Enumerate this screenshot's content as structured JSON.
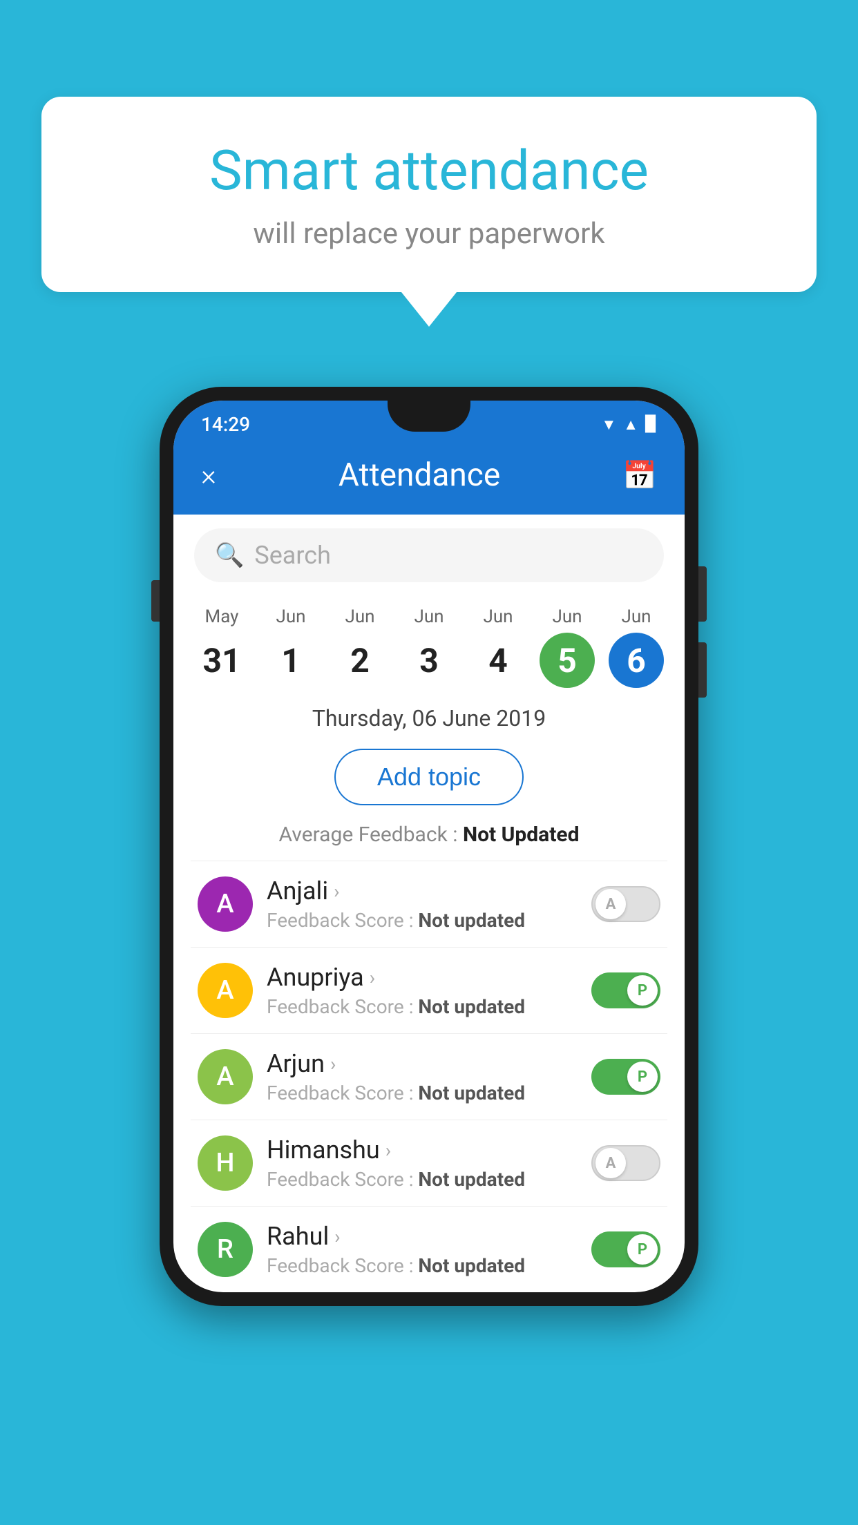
{
  "background_color": "#29b6d8",
  "speech_bubble": {
    "title": "Smart attendance",
    "subtitle": "will replace your paperwork"
  },
  "status_bar": {
    "time": "14:29",
    "icons": [
      "wifi",
      "signal",
      "battery"
    ]
  },
  "app_header": {
    "title": "Attendance",
    "close_label": "×",
    "calendar_icon": "📅"
  },
  "search": {
    "placeholder": "Search"
  },
  "calendar": {
    "days": [
      {
        "month": "May",
        "date": "31",
        "state": "normal"
      },
      {
        "month": "Jun",
        "date": "1",
        "state": "normal"
      },
      {
        "month": "Jun",
        "date": "2",
        "state": "normal"
      },
      {
        "month": "Jun",
        "date": "3",
        "state": "normal"
      },
      {
        "month": "Jun",
        "date": "4",
        "state": "normal"
      },
      {
        "month": "Jun",
        "date": "5",
        "state": "today"
      },
      {
        "month": "Jun",
        "date": "6",
        "state": "selected"
      }
    ]
  },
  "date_display": "Thursday, 06 June 2019",
  "add_topic_label": "Add topic",
  "average_feedback": {
    "label": "Average Feedback : ",
    "value": "Not Updated"
  },
  "students": [
    {
      "name": "Anjali",
      "avatar_letter": "A",
      "avatar_color": "#9c27b0",
      "feedback_label": "Feedback Score : ",
      "feedback_value": "Not updated",
      "attendance": "absent",
      "toggle_letter": "A"
    },
    {
      "name": "Anupriya",
      "avatar_letter": "A",
      "avatar_color": "#ffc107",
      "feedback_label": "Feedback Score : ",
      "feedback_value": "Not updated",
      "attendance": "present",
      "toggle_letter": "P"
    },
    {
      "name": "Arjun",
      "avatar_letter": "A",
      "avatar_color": "#8bc34a",
      "feedback_label": "Feedback Score : ",
      "feedback_value": "Not updated",
      "attendance": "present",
      "toggle_letter": "P"
    },
    {
      "name": "Himanshu",
      "avatar_letter": "H",
      "avatar_color": "#8bc34a",
      "feedback_label": "Feedback Score : ",
      "feedback_value": "Not updated",
      "attendance": "absent",
      "toggle_letter": "A"
    },
    {
      "name": "Rahul",
      "avatar_letter": "R",
      "avatar_color": "#4caf50",
      "feedback_label": "Feedback Score : ",
      "feedback_value": "Not updated",
      "attendance": "present",
      "toggle_letter": "P"
    }
  ]
}
